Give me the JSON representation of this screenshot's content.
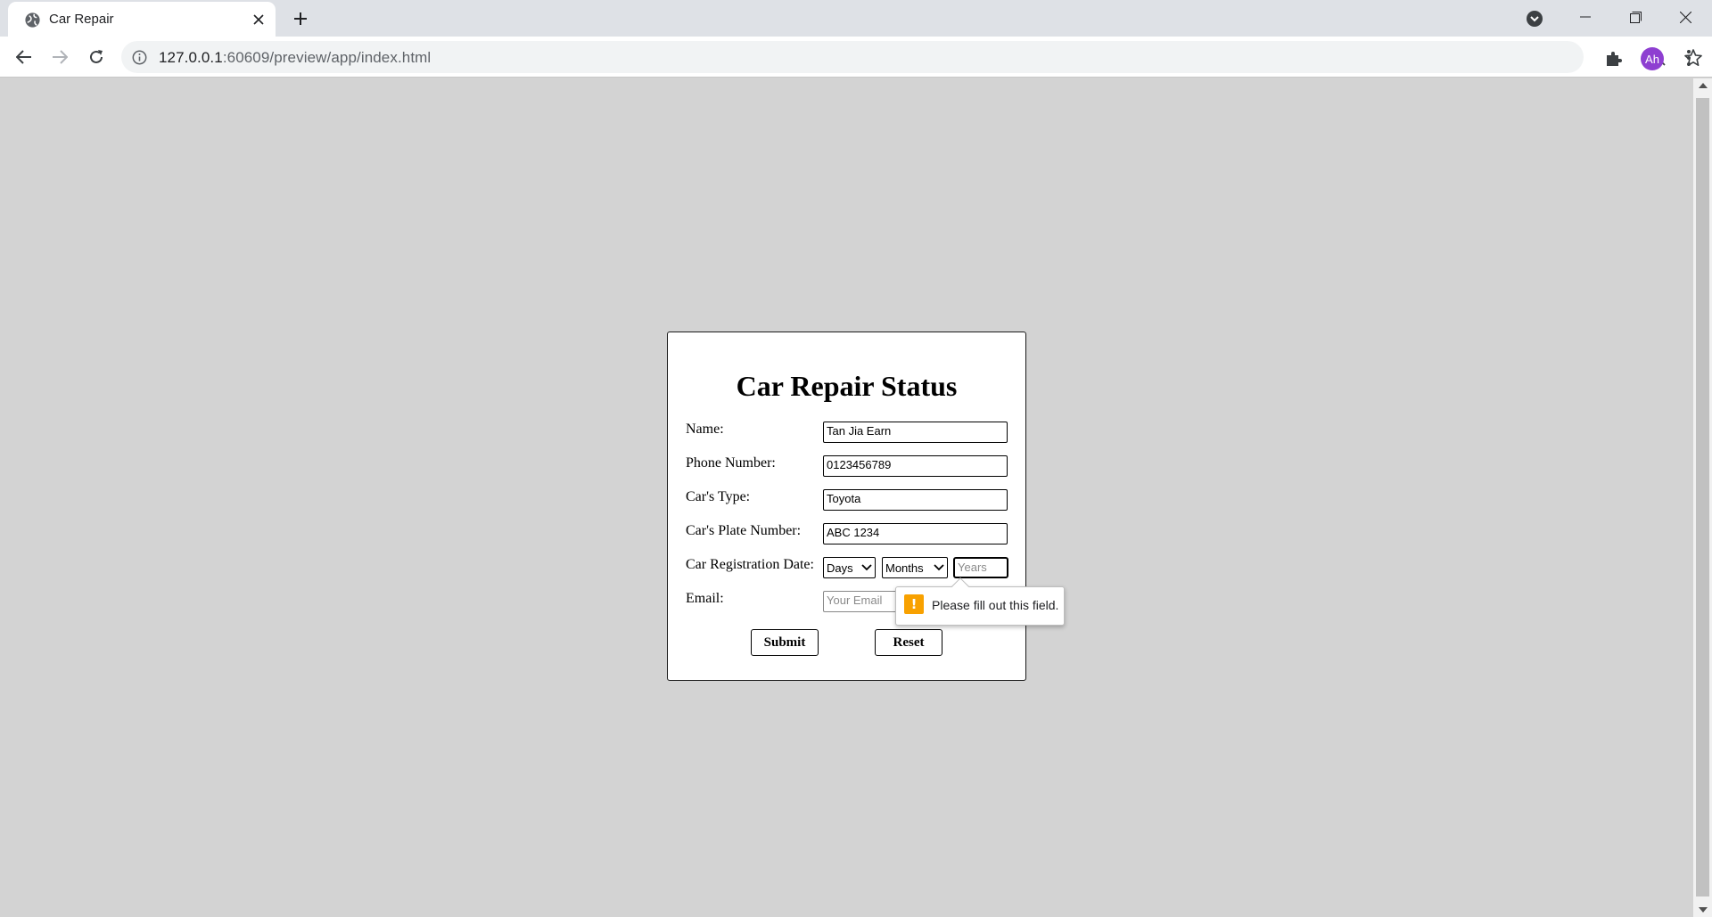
{
  "browser": {
    "tab_title": "Car Repair",
    "url_host": "127.0.0.1",
    "url_rest": ":60609/preview/app/index.html",
    "avatar_initials": "Ah",
    "accent_color": "#8e3fd1"
  },
  "form": {
    "title": "Car Repair Status",
    "fields": {
      "name": {
        "label": "Name:",
        "value": "Tan Jia Earn"
      },
      "phone": {
        "label": "Phone Number:",
        "value": "0123456789"
      },
      "car_type": {
        "label": "Car's Type:",
        "value": "Toyota"
      },
      "plate": {
        "label": "Car's Plate Number:",
        "value": "ABC 1234"
      },
      "registration": {
        "label": "Car Registration Date:",
        "day_selected": "Days",
        "month_selected": "Months",
        "year_placeholder": "Years"
      },
      "email": {
        "label": "Email:",
        "placeholder": "Your Email"
      }
    },
    "submit_label": "Submit",
    "reset_label": "Reset"
  },
  "validation": {
    "message": "Please fill out this field.",
    "icon": "warning-icon",
    "color": "#f8a100"
  }
}
